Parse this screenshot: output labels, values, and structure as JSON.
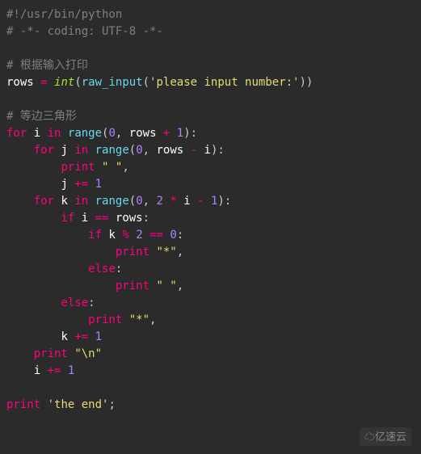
{
  "code": {
    "l1": {
      "shebang": "#!/usr/bin/python"
    },
    "l2": {
      "coding": "# -*- coding: UTF-8 -*-"
    },
    "l3": {
      "blank": ""
    },
    "l4": {
      "comment1": "# 根据输入打印"
    },
    "l5": {
      "rows": "rows",
      "eq": " = ",
      "int": "int",
      "lp": "(",
      "raw": "raw_input",
      "lp2": "(",
      "str": "'please input number:'",
      "rp2": ")",
      "rp": ")"
    },
    "l6": {
      "blank": ""
    },
    "l7": {
      "comment2": "# 等边三角形"
    },
    "l8": {
      "for": "for",
      "sp": " ",
      "i": "i",
      "in": " in ",
      "range": "range",
      "lp": "(",
      "z": "0",
      "c": ", ",
      "rows": "rows",
      "plus": " + ",
      "one": "1",
      "rp": "):"
    },
    "l9": {
      "indent": "    ",
      "for": "for",
      "sp": " ",
      "j": "j",
      "in": " in ",
      "range": "range",
      "lp": "(",
      "z": "0",
      "c": ", ",
      "rows": "rows",
      "minus": " - ",
      "i": "i",
      "rp": "):"
    },
    "l10": {
      "indent": "        ",
      "print": "print",
      "sp": " ",
      "str": "\" \"",
      "c": ","
    },
    "l11": {
      "indent": "        ",
      "j": "j",
      "pe": " += ",
      "one": "1"
    },
    "l12": {
      "indent": "    ",
      "for": "for",
      "sp": " ",
      "k": "k",
      "in": " in ",
      "range": "range",
      "lp": "(",
      "z": "0",
      "c": ", ",
      "two": "2",
      "mul": " * ",
      "i": "i",
      "minus": " - ",
      "one": "1",
      "rp": "):"
    },
    "l13": {
      "indent": "        ",
      "if": "if",
      "sp": " ",
      "i": "i",
      "eq": " == ",
      "rows": "rows",
      "col": ":"
    },
    "l14": {
      "indent": "            ",
      "if": "if",
      "sp": " ",
      "k": "k",
      "mod": " % ",
      "two": "2",
      "eq": " == ",
      "z": "0",
      "col": ":"
    },
    "l15": {
      "indent": "                ",
      "print": "print",
      "sp": " ",
      "str": "\"*\"",
      "c": ","
    },
    "l16": {
      "indent": "            ",
      "else": "else",
      "col": ":"
    },
    "l17": {
      "indent": "                ",
      "print": "print",
      "sp": " ",
      "str": "\" \"",
      "c": ","
    },
    "l18": {
      "indent": "        ",
      "else": "else",
      "col": ":"
    },
    "l19": {
      "indent": "            ",
      "print": "print",
      "sp": " ",
      "str": "\"*\"",
      "c": ","
    },
    "l20": {
      "indent": "        ",
      "k": "k",
      "pe": " += ",
      "one": "1"
    },
    "l21": {
      "indent": "    ",
      "print": "print",
      "sp": " ",
      "str": "\"\\n\""
    },
    "l22": {
      "indent": "    ",
      "i": "i",
      "pe": " += ",
      "one": "1"
    },
    "l23": {
      "blank": ""
    },
    "l24": {
      "print": "print",
      "sp": " ",
      "str": "'the end'",
      "semi": ";"
    }
  },
  "watermark": "亿速云"
}
